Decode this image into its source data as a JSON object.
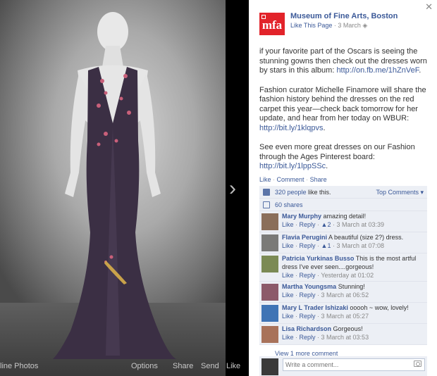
{
  "photo_stage": {
    "actions": [
      {
        "label": "line Photos"
      },
      {
        "label": "Options"
      },
      {
        "label": "Share"
      },
      {
        "label": "Send"
      },
      {
        "label": "Like"
      }
    ]
  },
  "post": {
    "page_name": "Museum of Fine Arts, Boston",
    "avatar_text": "mfa",
    "like_page_label": "Like This Page",
    "date": "3 March",
    "paragraphs": [
      {
        "text": "if your favorite part of the Oscars is seeing the stunning gowns then check out the dresses worn by stars in this album: ",
        "link": "http://on.fb.me/1hZnVeF",
        "suffix": "."
      },
      {
        "text": "Fashion curator Michelle Finamore will share the fashion history behind the dresses on the red carpet this year—check back tomorrow for her update, and hear from her today on WBUR: ",
        "link": "http://bit.ly/1klqpvs",
        "suffix": "."
      },
      {
        "text": "See even more great dresses on our Fashion through the Ages Pinterest board: ",
        "link": "http://bit.ly/1lppSSc",
        "suffix": "."
      }
    ],
    "actions": {
      "like": "Like",
      "comment": "Comment",
      "share": "Share"
    }
  },
  "feedback": {
    "likes_count": "320 people",
    "likes_suffix": " like this.",
    "sort_label": "Top Comments ▾",
    "shares": "60 shares"
  },
  "comments": [
    {
      "name": "Mary Murphy",
      "text": "amazing detail!",
      "likes": "2",
      "time": "3 March at 03:39",
      "avatar_color": "#8a6e5a"
    },
    {
      "name": "Flavia Perugini",
      "text": "A beautiful (size 2?) dress.",
      "likes": "1",
      "time": "3 March at 07:08",
      "avatar_color": "#7a7a78"
    },
    {
      "name": "Patricia Yurkinas Busso",
      "text": "This is the most artful dress I've ever seen....gorgeous!",
      "likes": "",
      "time": "Yesterday at 01:02",
      "avatar_color": "#7b8a55"
    },
    {
      "name": "Martha Youngsma",
      "text": "Stunning!",
      "likes": "",
      "time": "3 March at 06:52",
      "avatar_color": "#8c5a6a"
    },
    {
      "name": "Mary L Trader Ishizaki",
      "text": "ooooh ~ wow, lovely!",
      "likes": "",
      "time": "3 March at 05:27",
      "avatar_color": "#3f74b5"
    },
    {
      "name": "Lisa Richardson",
      "text": "Gorgeous!",
      "likes": "",
      "time": "3 March at 03:53",
      "avatar_color": "#a8725a"
    }
  ],
  "comment_labels": {
    "like": "Like",
    "reply": "Reply"
  },
  "view_more": "View 1 more comment",
  "composer": {
    "placeholder": "Write a comment..."
  },
  "colors": {
    "fb_blue": "#3b5998",
    "mfa_red": "#e2232a",
    "feedback_bg": "#eceff5"
  },
  "icons": [
    "close-icon",
    "thumbs-up-icon",
    "share-icon",
    "camera-icon",
    "globe-icon",
    "chevron-right-icon"
  ]
}
